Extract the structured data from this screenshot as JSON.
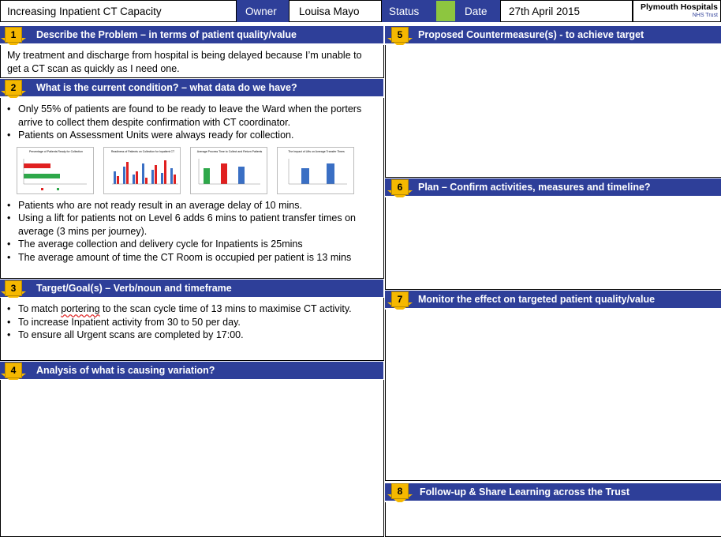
{
  "header": {
    "title": "Increasing Inpatient CT Capacity",
    "owner_label": "Owner",
    "owner": "Louisa Mayo",
    "status_label": "Status",
    "status_color": "#8dc63f",
    "date_label": "Date",
    "date": "27th April 2015",
    "logo_main": "Plymouth Hospitals",
    "logo_sub": "NHS Trust"
  },
  "colors": {
    "bar": "#2e3f99",
    "badge": "#f5b800"
  },
  "sections": {
    "s1": {
      "num": "1",
      "title": "Describe the Problem – in terms of patient quality/value",
      "text": "My treatment and discharge from hospital is being delayed because I’m unable to get a CT scan as quickly as I need one."
    },
    "s2": {
      "num": "2",
      "title": "What is the current condition? – what data do we have?",
      "bullets_a": [
        "Only 55% of patients are found to be ready to leave the Ward when the porters arrive to collect them despite confirmation with CT coordinator.",
        "Patients on Assessment Units were always ready for collection."
      ],
      "bullets_b": [
        "Patients who are not ready result in an average delay of 10 mins.",
        "Using a lift for patients not on Level 6 adds 6 mins to patient transfer times on average (3 mins per journey).",
        "The average collection and delivery cycle for Inpatients is 25mins",
        "The average amount of time the CT Room is occupied per patient is 13 mins"
      ],
      "charts": [
        "Percentage of Patients Ready for Collection",
        "Readiness of Patients on Collection for Inpatient CT",
        "Average Process Time to Collect and Return Patients",
        "The Impact of Lifts on Average Transfer Times"
      ]
    },
    "s3": {
      "num": "3",
      "title": "Target/Goal(s) – Verb/noun and  timeframe",
      "bullet1_pre": "To match ",
      "bullet1_squig": "portering",
      "bullet1_post": " to the scan cycle time of 13 mins to maximise CT activity.",
      "bullets": [
        "To increase Inpatient activity from 30 to 50 per day.",
        "To ensure all Urgent scans are completed by 17:00."
      ]
    },
    "s4": {
      "num": "4",
      "title": "Analysis of  what is causing variation?"
    },
    "s5": {
      "num": "5",
      "title": "Proposed Countermeasure(s) - to achieve target"
    },
    "s6": {
      "num": "6",
      "title": "Plan – Confirm activities, measures and timeline?"
    },
    "s7": {
      "num": "7",
      "title": "Monitor the effect  on targeted patient quality/value"
    },
    "s8": {
      "num": "8",
      "title": "Follow-up & Share Learning across the Trust"
    }
  }
}
